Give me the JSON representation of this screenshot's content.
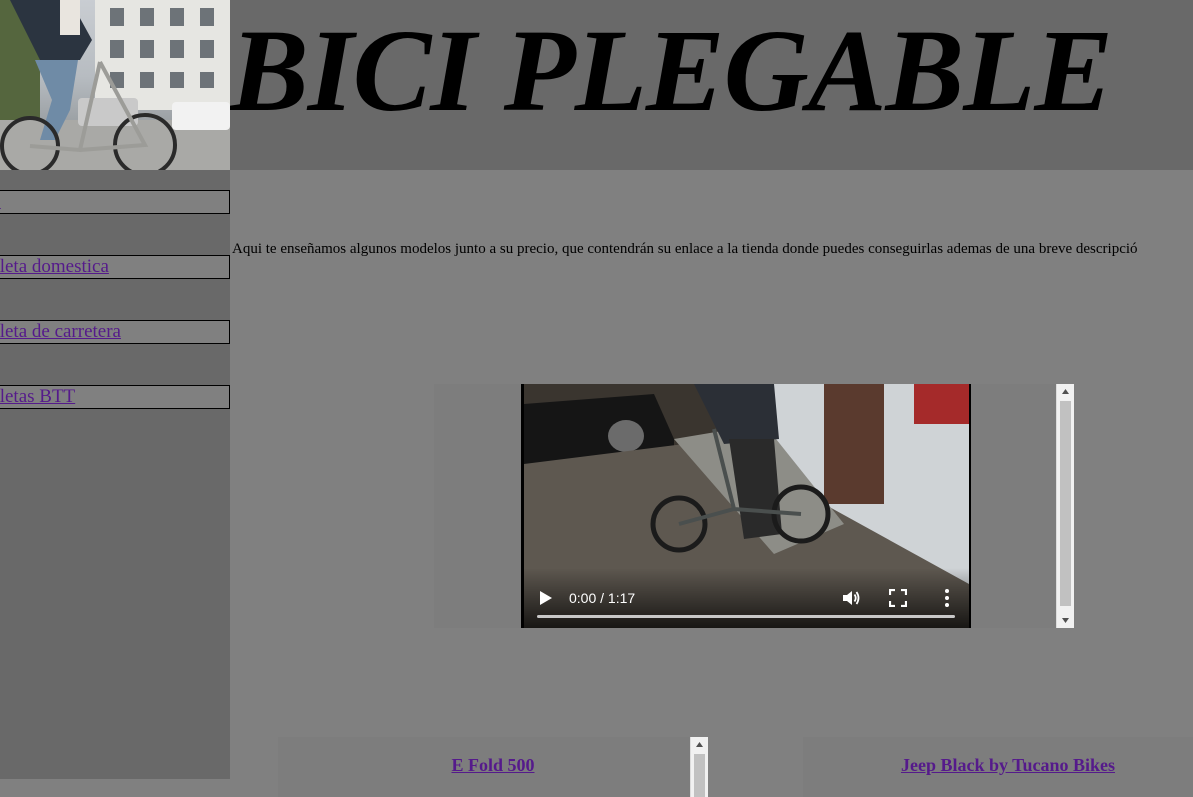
{
  "header": {
    "title": "BICI PLEGABLE",
    "photo_icon": "cyclist-photo"
  },
  "sidebar": {
    "items": [
      {
        "label": "io"
      },
      {
        "label": "icleta domestica"
      },
      {
        "label": "icleta de carretera"
      },
      {
        "label": "icletas BTT"
      }
    ]
  },
  "main": {
    "intro": "Aqui te enseñamos algunos modelos junto a su precio, que contendrán su enlace a la tienda donde puedes conseguirlas ademas de una breve descripció",
    "video": {
      "time": "0:00 / 1:17",
      "progress": 0,
      "icons": [
        "play-icon",
        "volume-icon",
        "fullscreen-icon",
        "more-options-icon"
      ]
    },
    "products": [
      {
        "name": "E Fold 500"
      },
      {
        "name": "Jeep Black by Tucano Bikes"
      }
    ]
  },
  "colors": {
    "page_bg": "#808080",
    "header_bg": "#696969",
    "sidebar_bg": "#696969",
    "link": "#551a8b"
  }
}
